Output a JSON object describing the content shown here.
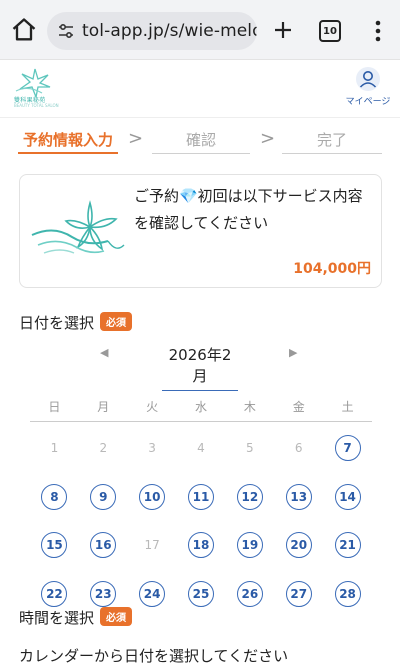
{
  "browser": {
    "url": "tol-app.jp/s/wie-melodie",
    "tab_count": "10"
  },
  "header": {
    "logo_text": "雙科果秘苑",
    "logo_sub": "BEAUTY TOTAL SALON",
    "mypage_label": "マイページ"
  },
  "steps": {
    "items": [
      "予約情報入力",
      "確認",
      "完了"
    ],
    "separator": ">"
  },
  "service": {
    "title": "ご予約💎初回は以下サービス内容を確認してください",
    "price": "104,000円"
  },
  "date_section": {
    "label": "日付を選択",
    "badge": "必須"
  },
  "calendar": {
    "prev": "◀",
    "next": "▶",
    "month": "2026年2月",
    "weekdays": [
      "日",
      "月",
      "火",
      "水",
      "木",
      "金",
      "土"
    ],
    "days": [
      {
        "d": "1",
        "available": false
      },
      {
        "d": "2",
        "available": false
      },
      {
        "d": "3",
        "available": false
      },
      {
        "d": "4",
        "available": false
      },
      {
        "d": "5",
        "available": false
      },
      {
        "d": "6",
        "available": false
      },
      {
        "d": "7",
        "available": true
      },
      {
        "d": "8",
        "available": true
      },
      {
        "d": "9",
        "available": true
      },
      {
        "d": "10",
        "available": true
      },
      {
        "d": "11",
        "available": true
      },
      {
        "d": "12",
        "available": true
      },
      {
        "d": "13",
        "available": true
      },
      {
        "d": "14",
        "available": true
      },
      {
        "d": "15",
        "available": true
      },
      {
        "d": "16",
        "available": true
      },
      {
        "d": "17",
        "available": false
      },
      {
        "d": "18",
        "available": true
      },
      {
        "d": "19",
        "available": true
      },
      {
        "d": "20",
        "available": true
      },
      {
        "d": "21",
        "available": true
      },
      {
        "d": "22",
        "available": true
      },
      {
        "d": "23",
        "available": true
      },
      {
        "d": "24",
        "available": true
      },
      {
        "d": "25",
        "available": true
      },
      {
        "d": "26",
        "available": true
      },
      {
        "d": "27",
        "available": true
      },
      {
        "d": "28",
        "available": true
      }
    ]
  },
  "time_section": {
    "label": "時間を選択",
    "badge": "必須",
    "hint": "カレンダーから日付を選択してください"
  },
  "colors": {
    "accent": "#e8712b",
    "link": "#2a5aa6",
    "brand": "#3fb5ad"
  },
  "icons": {
    "home": "home-icon",
    "site_info": "site-info-icon",
    "new_tab": "plus-icon",
    "tabs": "tabs-icon",
    "menu": "kebab-menu-icon",
    "account": "user-icon"
  }
}
